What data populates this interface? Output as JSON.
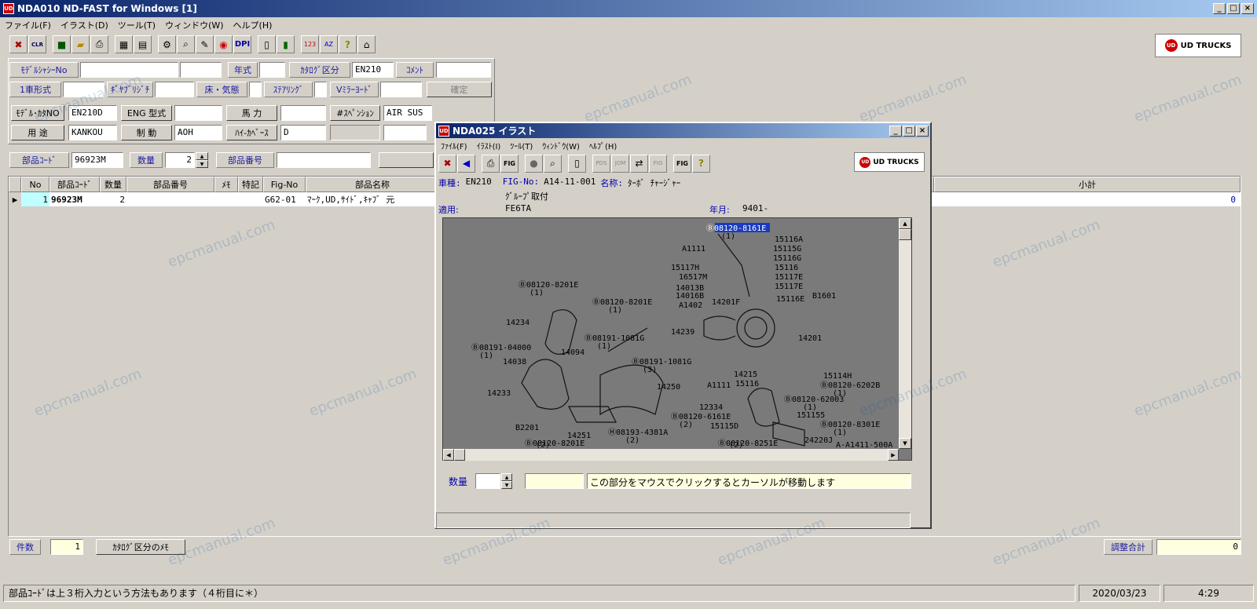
{
  "window": {
    "title": "NDA010 ND-FAST for Windows [1]",
    "app_icon": "UD"
  },
  "menu": [
    "ファイル(F)",
    "イラスト(D)",
    "ツール(T)",
    "ウィンドウ(W)",
    "ヘルプ(H)"
  ],
  "toolbar": {
    "clr_label": "CLR",
    "logo": "UD TRUCKS",
    "logo_badge": "UD"
  },
  "form": {
    "model_chassis_label": "ﾓﾃﾞﾙｼｬｼｰNo",
    "model_chassis_value": "",
    "year_label": "年式",
    "year_value": "",
    "catalog_label": "ｶﾀﾛｸﾞ区分",
    "catalog_value": "EN210",
    "comment_label": "ｺﾒﾝﾄ",
    "comment_value": "",
    "vehicle_type_label": "1車形式",
    "vehicle_type_value": "",
    "gear_ratio_label": "ｷﾞﾔﾌﾞﾘｼﾞﾁ",
    "gear_ratio_value": "",
    "floor_label": "床・気態",
    "floor_value": "",
    "steering_label": "ｽﾃｱﾘﾝｸﾞ",
    "steering_value": "",
    "vmirror_label": "Vﾐﾗｰﾖｰﾄﾞ",
    "vmirror_value": "",
    "confirm_label": "確定",
    "model_catalog_label": "ﾓﾃﾞﾙ･ｶﾀNO",
    "model_catalog_value": "EN210D",
    "eng_label": "ENG 型式",
    "eng_value": "",
    "power_label": "馬 力",
    "power_value": "",
    "suspension_label": "#ｽﾍﾟﾝｼｮﾝ",
    "suspension_value": "AIR SUS",
    "usage_label": "用 途",
    "usage_value": "KANKOU",
    "brake_label": "制 動",
    "brake_value": "AOH",
    "hybase_label": "ﾊｲ-ｶﾍﾞｰｽ",
    "hybase_value": "D",
    "extra1": "",
    "extra2": ""
  },
  "search": {
    "part_code_label": "部品ｺｰﾄﾞ",
    "part_code_value": "96923M",
    "qty_label": "数量",
    "qty_value": "2",
    "part_no_label": "部品番号",
    "part_no_value": ""
  },
  "grid": {
    "headers": [
      "No",
      "部品ｺｰﾄﾞ",
      "数量",
      "部品番号",
      "ﾒﾓ",
      "特記",
      "Fig-No",
      "部品名称",
      "小計"
    ],
    "row": {
      "no": "1",
      "code": "96923M",
      "qty": "2",
      "part_no": "",
      "memo": "",
      "note": "",
      "fig": "G62-01",
      "name": "ﾏｰｸ,UD,ｻｲﾄﾞ,ｷｬﾌﾞ 元",
      "subtotal": "0"
    }
  },
  "footer": {
    "count_label": "件数",
    "count_value": "1",
    "catalog_memo_btn": "ｶﾀﾛｸﾞ区分のﾒﾓ",
    "adjust_label": "調整合計",
    "adjust_value": "0"
  },
  "status": {
    "hint": "部品ｺｰﾄﾞは上３桁入力という方法もあります（４桁目に＊）",
    "date": "2020/03/23",
    "time": "4:29"
  },
  "illustration_window": {
    "title": "NDA025 イラスト",
    "menu": [
      "ﾌｧｲﾙ(F)",
      "ｲﾗｽﾄ(I)",
      "ﾂｰﾙ(T)",
      "ｳｨﾝﾄﾞｳ(W)",
      "ﾍﾙﾌﾟ(H)"
    ],
    "toolbar_labels": [
      "FIG",
      "PDS",
      "JOM",
      "FIG",
      "FIG"
    ],
    "vehicle_label": "車種:",
    "vehicle_value": "EN210",
    "fig_label": "FIG-No:",
    "fig_value": "A14-11-001",
    "name_label": "名称:",
    "name_value": "ﾀｰﾎﾞ ﾁｬｰｼﾞｬｰ",
    "group_value": "ｸﾞﾙｰﾌﾟ取付",
    "apply_label": "適用:",
    "apply_value": "FE6TA",
    "date_label": "年月:",
    "date_value": "9401-",
    "qty_label": "数量",
    "qty_value": "",
    "field_value": "",
    "hint": "この部分をマウスでクリックするとカーソルが移動します",
    "drawing_code": "A-A1411-500A",
    "parts": [
      "Ⓑ08120-8161E",
      "(1)",
      "15116A",
      "15115G",
      "15116G",
      "A1111",
      "15117H",
      "16517M",
      "15116",
      "15117E",
      "15117E",
      "14013B",
      "14016B",
      "A1402",
      "14201F",
      "15116E",
      "B1601",
      "Ⓑ08120-8201E",
      "(1)",
      "Ⓑ08120-8201E",
      "(1)",
      "14234",
      "14239",
      "Ⓑ08191-1081G",
      "(1)",
      "14201",
      "Ⓑ08191-04000",
      "(1)",
      "14094",
      "14038",
      "Ⓑ08191-1081G",
      "(3)",
      "14215",
      "15114H",
      "15116",
      "Ⓑ08120-6202B",
      "(1)",
      "A1111",
      "Ⓑ08120-62003",
      "(1)",
      "14233",
      "14250",
      "12334",
      "151155",
      "Ⓑ08120-6161E",
      "(2)",
      "15115D",
      "Ⓑ08120-8301E",
      "(1)",
      "B2201",
      "14251",
      "Ⓗ08193-4381A",
      "(2)",
      "24220J",
      "Ⓑ08120-8201E",
      "(2)",
      "Ⓑ08120-8251E",
      "(2)"
    ]
  },
  "watermark": "epcmanual.com"
}
